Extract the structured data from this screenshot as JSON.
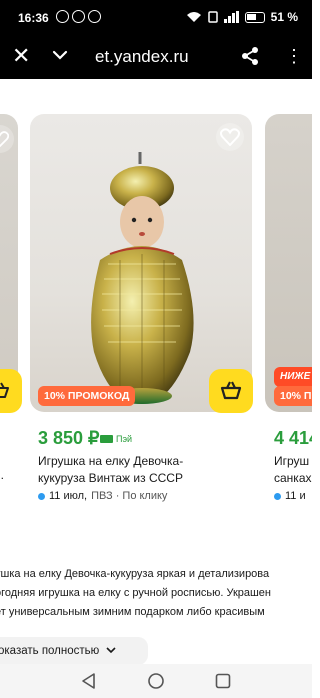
{
  "status": {
    "time": "16:36",
    "battery": "51 %",
    "notif_icons": [
      "whatsapp-icon",
      "whatsapp-icon",
      "whatsapp-icon"
    ]
  },
  "browser": {
    "url": "et.yandex.ru"
  },
  "cards": {
    "main": {
      "promo": "10% ПРОМОКОД",
      "price": "3 850 ₽",
      "payment": "Пэй",
      "title_line1": "Игрушка на елку Девочка-",
      "title_line2": "кукуруза Винтаж из СССР",
      "delivery_date": "11 июл,",
      "delivery_rest": "ПВЗ · По клику"
    },
    "left": {
      "title_fragment": "..."
    },
    "right": {
      "promo_top": "НИЖЕ Р",
      "promo_bottom": "10% ПР",
      "price": "4 414",
      "title_line1": "Игруш",
      "title_line2": "санках",
      "delivery_date": "11 и"
    }
  },
  "description": {
    "line1": "ушка на елку Девочка-кукуруза яркая и детализирова",
    "line2": "огодняя игрушка на елку с ручной росписью. Украшен",
    "line3": "ет универсальным зимним подарком либо красивым "
  },
  "show_more": {
    "label": "оказать полностью"
  },
  "colors": {
    "accent_yellow": "#ffdb1f",
    "price_green": "#2a9d3c",
    "promo_orange": "#ff6a3c"
  }
}
